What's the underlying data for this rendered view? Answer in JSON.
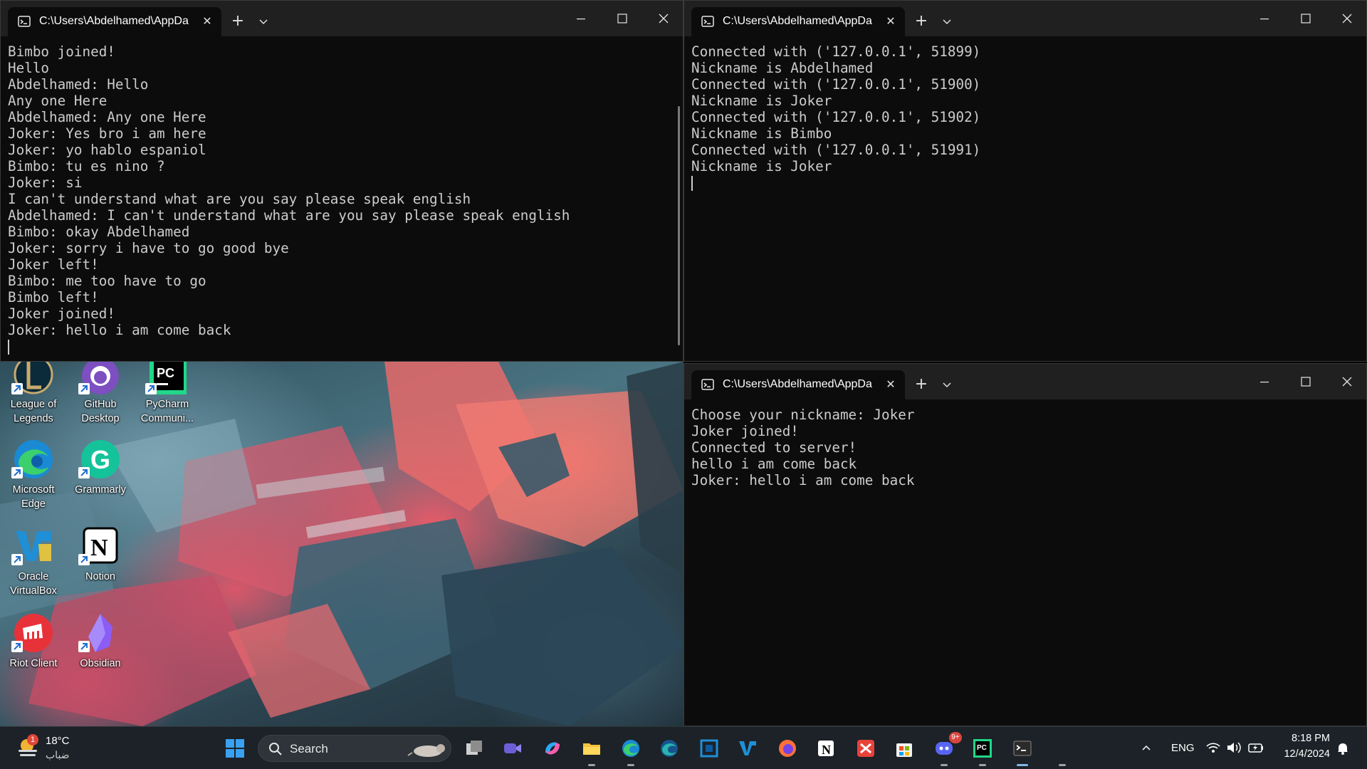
{
  "terminals": {
    "client_abdelhamed": {
      "tab_title": "C:\\Users\\Abdelhamed\\AppDa",
      "lines": [
        "Bimbo joined!",
        "Hello",
        "Abdelhamed: Hello",
        "Any one Here",
        "Abdelhamed: Any one Here",
        "Joker: Yes bro i am here",
        "Joker: yo hablo espaniol",
        "Bimbo: tu es nino ?",
        "Joker: si",
        "I can't understand what are you say please speak english",
        "Abdelhamed: I can't understand what are you say please speak english",
        "Bimbo: okay Abdelhamed",
        "Joker: sorry i have to go good bye",
        "Joker left!",
        "Bimbo: me too have to go",
        "Bimbo left!",
        "Joker joined!",
        "Joker: hello i am come back"
      ]
    },
    "server": {
      "tab_title": "C:\\Users\\Abdelhamed\\AppDa",
      "lines": [
        "Connected with ('127.0.0.1', 51899)",
        "Nickname is Abdelhamed",
        "Connected with ('127.0.0.1', 51900)",
        "Nickname is Joker",
        "Connected with ('127.0.0.1', 51902)",
        "Nickname is Bimbo",
        "Connected with ('127.0.0.1', 51991)",
        "Nickname is Joker"
      ]
    },
    "client_joker": {
      "tab_title": "C:\\Users\\Abdelhamed\\AppDa",
      "lines": [
        "Choose your nickname: Joker",
        "Joker joined!",
        "Connected to server!",
        "hello i am come back",
        "Joker: hello i am come back"
      ]
    }
  },
  "desktop_icons": [
    {
      "label": "League of Legends",
      "icon": "league-of-legends-icon"
    },
    {
      "label": "GitHub Desktop",
      "icon": "github-desktop-icon"
    },
    {
      "label": "PyCharm Communi...",
      "icon": "pycharm-icon"
    },
    {
      "label": "Microsoft Edge",
      "icon": "edge-icon"
    },
    {
      "label": "Grammarly",
      "icon": "grammarly-icon"
    },
    {
      "label": "Oracle VirtualBox",
      "icon": "virtualbox-icon"
    },
    {
      "label": "Notion",
      "icon": "notion-icon"
    },
    {
      "label": "Riot Client",
      "icon": "riot-client-icon"
    },
    {
      "label": "Obsidian",
      "icon": "obsidian-icon"
    }
  ],
  "taskbar": {
    "weather": {
      "temp": "18°C",
      "condition": "ضباب",
      "badge": "1"
    },
    "search_label": "Search",
    "discord_badge": "9+",
    "tray": {
      "language": "ENG",
      "time": "8:18 PM",
      "date": "12/4/2024"
    }
  },
  "colors": {
    "terminal_bg": "#0c0c0c",
    "titlebar_bg": "#202020",
    "terminal_text": "#cccccc",
    "taskbar_bg": "#1c2227"
  }
}
